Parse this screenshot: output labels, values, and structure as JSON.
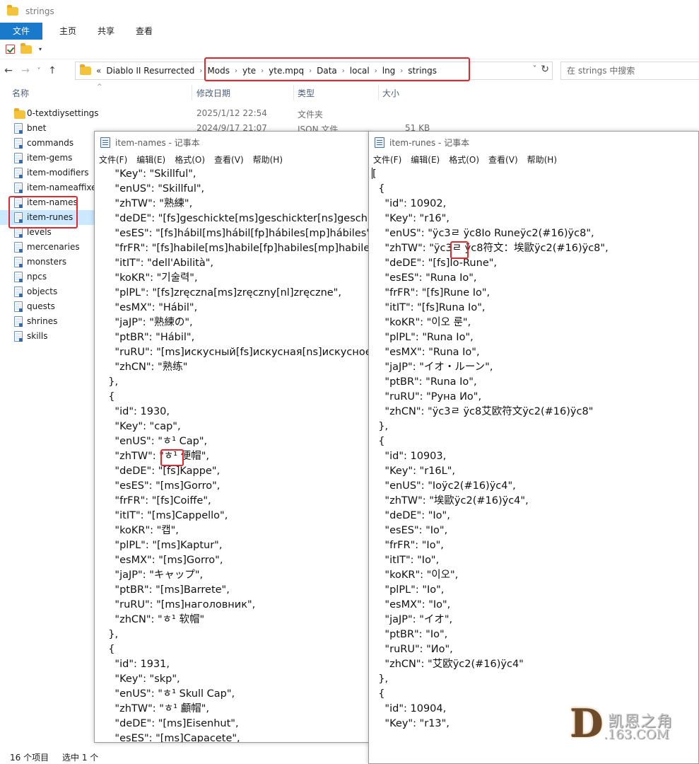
{
  "explorer": {
    "title": "strings",
    "ribbon_tabs": [
      "文件",
      "主页",
      "共享",
      "查看"
    ],
    "nav_back_label": "←",
    "nav_forward_label": "→",
    "nav_recent_label": "˅",
    "nav_up_label": "↑",
    "address_prefix": "«",
    "breadcrumb": [
      "Diablo II Resurrected",
      "Mods",
      "yte",
      "yte.mpq",
      "Data",
      "local",
      "lng",
      "strings"
    ],
    "address_dropdown_label": "˅",
    "refresh_label": "↻",
    "search_placeholder": "在 strings 中搜索",
    "columns": {
      "name": "名称",
      "date": "修改日期",
      "type": "类型",
      "size": "大小"
    },
    "files": [
      {
        "name": "0-textdiysettings",
        "kind": "folder",
        "date": "2025/1/12 22:54",
        "type": "文件夹",
        "size": ""
      },
      {
        "name": "bnet",
        "kind": "json",
        "date": "2024/9/17 21:07",
        "type": "JSON 文件",
        "size": "51 KB"
      },
      {
        "name": "commands",
        "kind": "json"
      },
      {
        "name": "item-gems",
        "kind": "json"
      },
      {
        "name": "item-modifiers",
        "kind": "json"
      },
      {
        "name": "item-nameaffixes",
        "kind": "json"
      },
      {
        "name": "item-names",
        "kind": "json"
      },
      {
        "name": "item-runes",
        "kind": "json",
        "selected": true
      },
      {
        "name": "levels",
        "kind": "json"
      },
      {
        "name": "mercenaries",
        "kind": "json"
      },
      {
        "name": "monsters",
        "kind": "json"
      },
      {
        "name": "npcs",
        "kind": "json"
      },
      {
        "name": "objects",
        "kind": "json"
      },
      {
        "name": "quests",
        "kind": "json"
      },
      {
        "name": "shrines",
        "kind": "json"
      },
      {
        "name": "skills",
        "kind": "json"
      }
    ],
    "status_count": "16 个项目",
    "status_selected": "选中 1 个"
  },
  "notepad_left": {
    "title": "item-names - 记事本",
    "menu": [
      "文件(F)",
      "编辑(E)",
      "格式(O)",
      "查看(V)",
      "帮助(H)"
    ],
    "lines": [
      "    \"Key\": \"Skillful\",",
      "    \"enUS\": \"Skillful\",",
      "    \"zhTW\": \"熟練\",",
      "    \"deDE\": \"[fs]geschickte[ms]geschickter[ns]geschickt",
      "    \"esES\": \"[fs]hábil[ms]hábil[fp]hábiles[mp]hábiles\",",
      "    \"frFR\": \"[fs]habile[ms]habile[fp]habiles[mp]habiles",
      "    \"itIT\": \"dell'Abilità\",",
      "    \"koKR\": \"기술력\",",
      "    \"plPL\": \"[fs]zręczna[ms]zręczny[nl]zręczne\",",
      "    \"esMX\": \"Hábil\",",
      "    \"jaJP\": \"熟練の\",",
      "    \"ptBR\": \"Hábil\",",
      "    \"ruRU\": \"[ms]искусный[fs]искусная[ns]искусное",
      "    \"zhCN\": \"熟练\"",
      "  },",
      "  {",
      "    \"id\": 1930,",
      "    \"Key\": \"cap\",",
      "    \"enUS\": \"ㅎ¹ Cap\",",
      "    \"zhTW\": \"ㅎ¹ 便帽\",",
      "    \"deDE\": \"[fs]Kappe\",",
      "    \"esES\": \"[ms]Gorro\",",
      "    \"frFR\": \"[fs]Coiffe\",",
      "    \"itIT\": \"[ms]Cappello\",",
      "    \"koKR\": \"캡\",",
      "    \"plPL\": \"[ms]Kaptur\",",
      "    \"esMX\": \"[ms]Gorro\",",
      "    \"jaJP\": \"キャップ\",",
      "    \"ptBR\": \"[ms]Barrete\",",
      "    \"ruRU\": \"[ms]наголовник\",",
      "    \"zhCN\": \"ㅎ¹ 软帽\"",
      "  },",
      "  {",
      "    \"id\": 1931,",
      "    \"Key\": \"skp\",",
      "    \"enUS\": \"ㅎ¹ Skull Cap\",",
      "    \"zhTW\": \"ㅎ¹ 顱帽\",",
      "    \"deDE\": \"[ms]Eisenhut\",",
      "    \"esES\": \"[ms]Capacete\","
    ]
  },
  "notepad_right": {
    "title": "item-runes - 记事本",
    "menu": [
      "文件(F)",
      "编辑(E)",
      "格式(O)",
      "查看(V)",
      "帮助(H)"
    ],
    "lines": [
      "[",
      "  {",
      "    \"id\": 10902,",
      "    \"Key\": \"r16\",",
      "    \"enUS\": \"ÿc3ㄹ ÿc8Io Runeÿc2(#16)ÿc8\",",
      "    \"zhTW\": \"ÿc3ㄹ ÿc8符文：埃歐ÿc2(#16)ÿc8\",",
      "    \"deDE\": \"[fs]Io-Rune\",",
      "    \"esES\": \"Runa Io\",",
      "    \"frFR\": \"[fs]Rune Io\",",
      "    \"itIT\": \"[fs]Runa Io\",",
      "    \"koKR\": \"이오 룬\",",
      "    \"plPL\": \"Runa Io\",",
      "    \"esMX\": \"Runa Io\",",
      "    \"jaJP\": \"イオ・ルーン\",",
      "    \"ptBR\": \"Runa Io\",",
      "    \"ruRU\": \"Руна Ио\",",
      "    \"zhCN\": \"ÿc3ㄹ ÿc8艾欧符文ÿc2(#16)ÿc8\"",
      "  },",
      "  {",
      "    \"id\": 10903,",
      "    \"Key\": \"r16L\",",
      "    \"enUS\": \"Ioÿc2(#16)ÿc4\",",
      "    \"zhTW\": \"埃歐ÿc2(#16)ÿc4\",",
      "    \"deDE\": \"Io\",",
      "    \"esES\": \"Io\",",
      "    \"frFR\": \"Io\",",
      "    \"itIT\": \"Io\",",
      "    \"koKR\": \"이오\",",
      "    \"plPL\": \"Io\",",
      "    \"esMX\": \"Io\",",
      "    \"jaJP\": \"イオ\",",
      "    \"ptBR\": \"Io\",",
      "    \"ruRU\": \"Ио\",",
      "    \"zhCN\": \"艾欧ÿc2(#16)ÿc4\"",
      "  },",
      "  {",
      "    \"id\": 10904,",
      "    \"Key\": \"r13\","
    ]
  },
  "watermark": {
    "brand_cn": "凯恩之角",
    "url": ".163.COM",
    "logo_letter": "D"
  },
  "colors": {
    "accent": "#1979ca",
    "highlight": "#e0282e",
    "selected_row": "#cce8ff"
  },
  "icons": [
    "folder-icon",
    "json-file-icon",
    "notepad-icon",
    "back-arrow-icon",
    "forward-arrow-icon",
    "up-arrow-icon",
    "refresh-icon",
    "dropdown-icon"
  ]
}
